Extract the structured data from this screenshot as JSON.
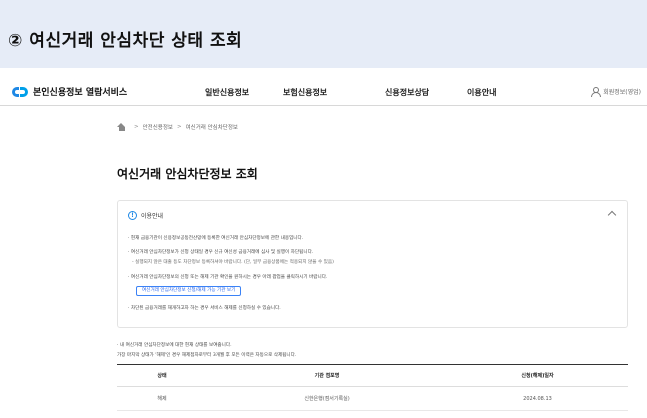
{
  "banner": {
    "title": "② 여신거래 안심차단 상태 조회"
  },
  "header": {
    "logo_text": "본인신용정보 열람서비스",
    "nav": [
      "일반신용정보",
      "보험신용정보",
      "신용정보상담",
      "이용안내"
    ],
    "member_label": "회원정보(영업)"
  },
  "breadcrumb": {
    "items": [
      "안전신용정보",
      "여신거래 안심차단정보"
    ]
  },
  "page": {
    "title": "여신거래 안심차단정보 조회"
  },
  "info": {
    "heading": "이용안내",
    "lines": [
      "· 현재 금융기관이 신용정보공동전산망에 등록한 여신거래 안심차단정보에 관한 내용입니다.",
      "· 여신거래 안심차단정보가 신청 상태일 경우 신규 여신성 금융거래에 심사 및 실행이 차단됩니다.",
      "- 실행되지 않은 대출 등도 차단정보 등록하셔야 바랍니다. (단, 일부 금융상품에는 적용되지 않을 수 있음)",
      "· 여신거래 안심차단정보의 신청 또는 해제 기관 확인을 원하시는 경우 아래 팝업을 클릭하시기 바랍니다.",
      "· 차단된 금융거래를 재개하고자 하는 경우 서비스 해제를 신청하실 수 있습니다."
    ],
    "link_button": "여신거래 안심차단정보 신청/해제 가능 기관 보기"
  },
  "notes": [
    "· 내 여신거래 안심차단정보에 대한 현재 상태를 보여줍니다.",
    "가장 마지막 상태가 '해제'인 경우 해제접자로부터 3개월 후 모든 이력은 자동으로 삭제됩니다."
  ],
  "table": {
    "headers": [
      "상태",
      "기관 점포명",
      "신청(해제)일자"
    ],
    "rows": [
      [
        "해제",
        "신한은행(점서기록실)",
        "2024.08.13"
      ]
    ]
  }
}
